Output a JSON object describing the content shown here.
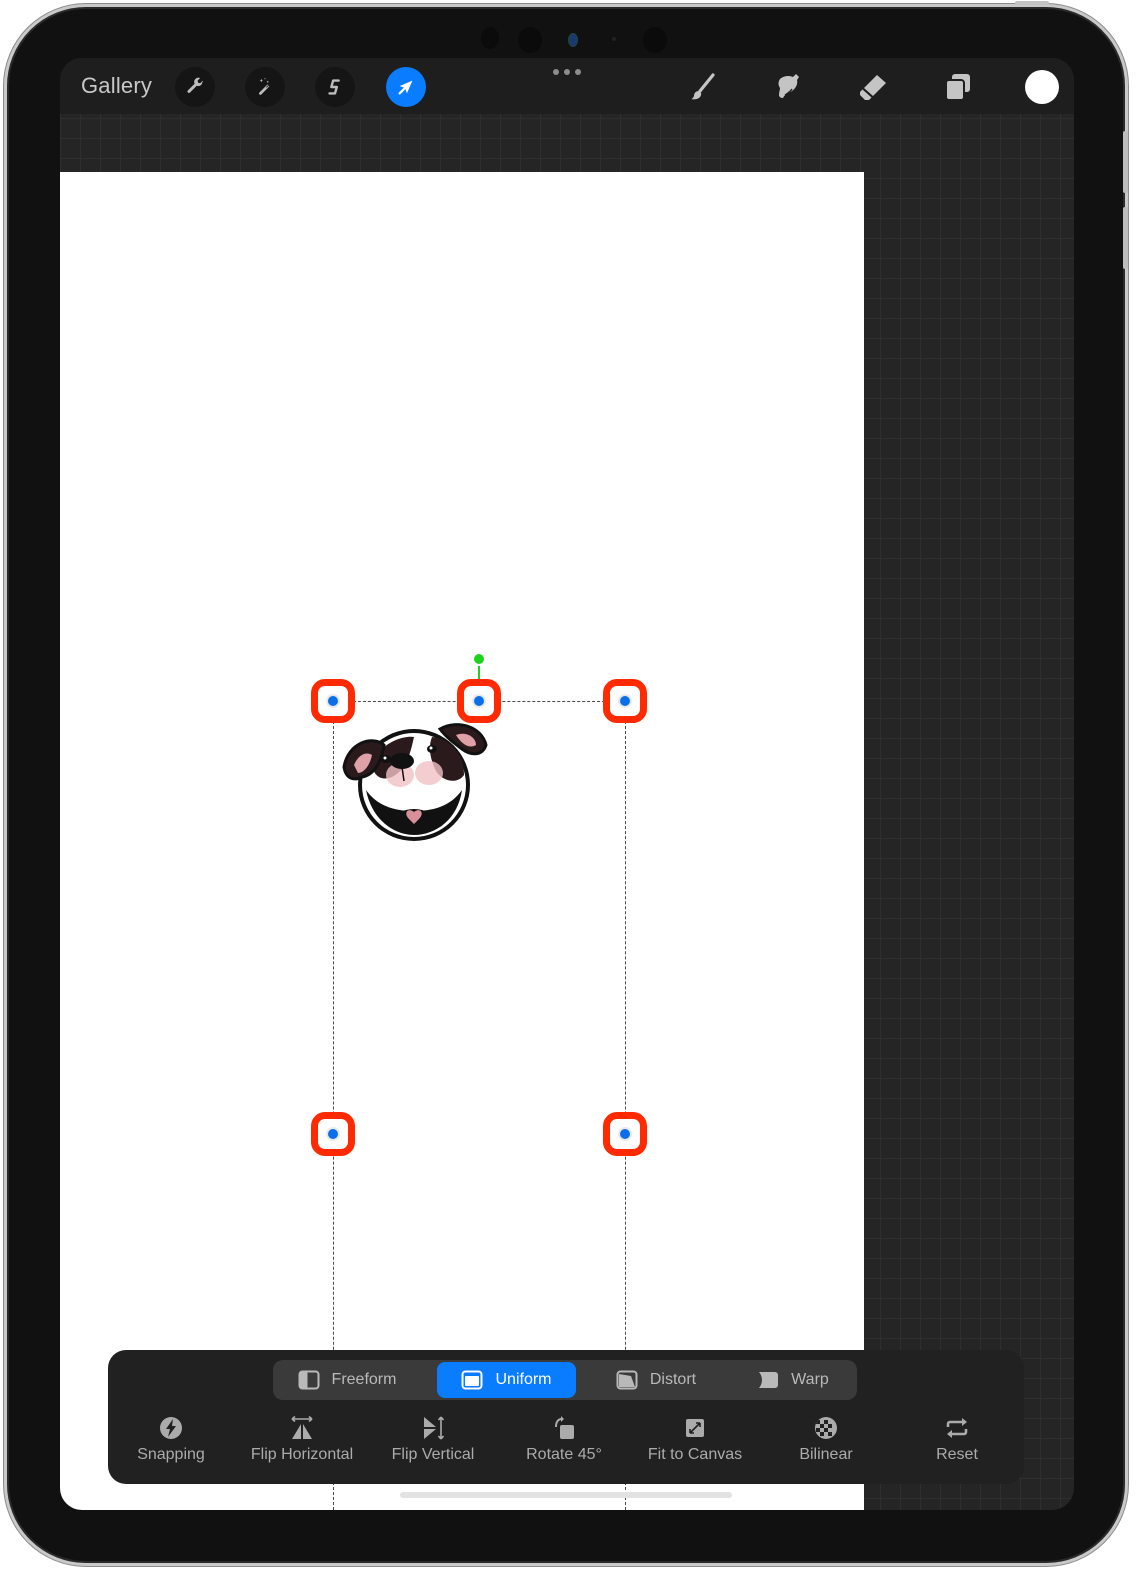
{
  "toolbar": {
    "gallery_label": "Gallery",
    "left_tools": [
      {
        "name": "actions",
        "icon": "wrench-icon",
        "active": false
      },
      {
        "name": "adjustments",
        "icon": "magic-wand-icon",
        "active": false
      },
      {
        "name": "selection",
        "icon": "selection-s-icon",
        "active": false
      },
      {
        "name": "transform",
        "icon": "arrow-cursor-icon",
        "active": true
      }
    ],
    "more_icon": "ellipsis-icon",
    "right_tools": [
      {
        "name": "brush",
        "icon": "brush-icon"
      },
      {
        "name": "smudge",
        "icon": "smudge-finger-icon"
      },
      {
        "name": "eraser",
        "icon": "eraser-icon"
      },
      {
        "name": "layers",
        "icon": "layers-icon"
      },
      {
        "name": "color",
        "icon": "color-swatch",
        "value": "#ffffff"
      }
    ]
  },
  "transform_panel": {
    "modes": [
      {
        "label": "Freeform",
        "active": false
      },
      {
        "label": "Uniform",
        "active": true
      },
      {
        "label": "Distort",
        "active": false
      },
      {
        "label": "Warp",
        "active": false
      }
    ],
    "actions": [
      {
        "label": "Snapping",
        "icon": "lightning-icon"
      },
      {
        "label": "Flip Horizontal",
        "icon": "flip-horizontal-icon"
      },
      {
        "label": "Flip Vertical",
        "icon": "flip-vertical-icon"
      },
      {
        "label": "Rotate 45°",
        "icon": "rotate-icon"
      },
      {
        "label": "Fit to Canvas",
        "icon": "fit-to-canvas-icon"
      },
      {
        "label": "Bilinear",
        "icon": "checker-ball-icon"
      },
      {
        "label": "Reset",
        "icon": "reset-arrows-icon"
      }
    ]
  },
  "colors": {
    "accent": "#0a7cff",
    "handle_highlight": "#ff2a00",
    "rotation_handle": "#1ed21e",
    "handle_dot": "#0a6fe8"
  }
}
